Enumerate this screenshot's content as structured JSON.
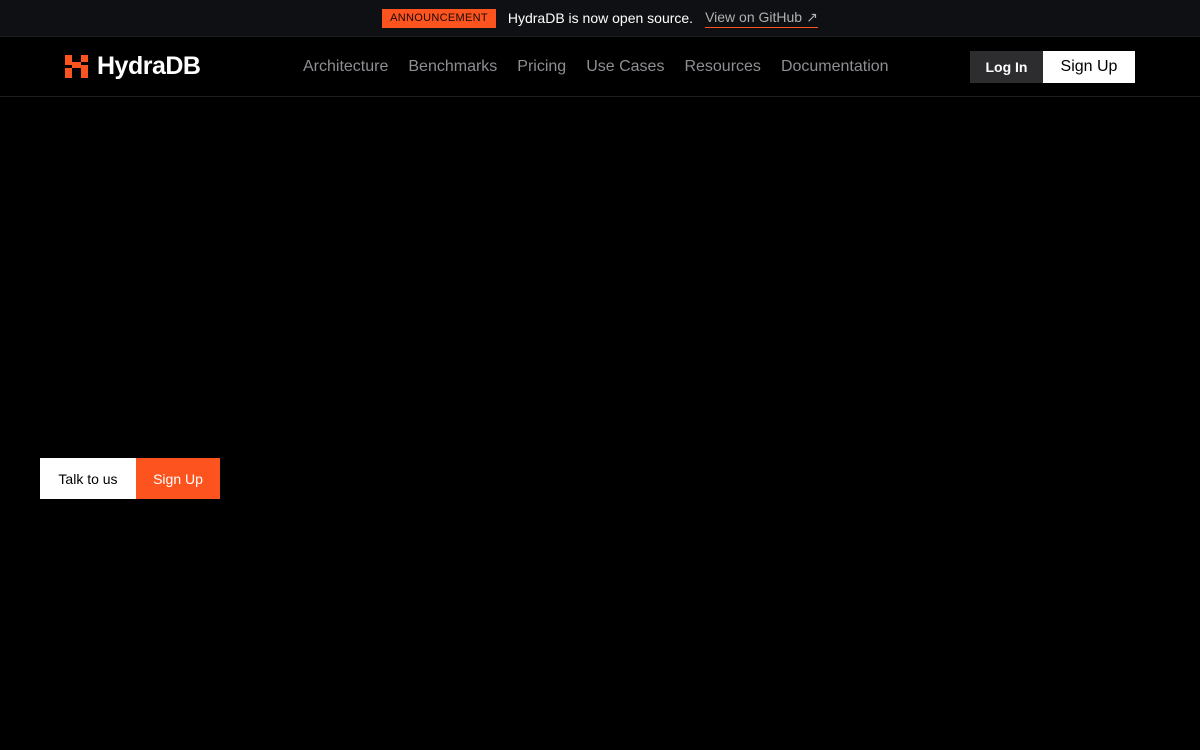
{
  "announcement": {
    "badge": "ANNOUNCEMENT",
    "text": "HydraDB is now open source.",
    "link_label": "View on GitHub",
    "link_arrow": "↗"
  },
  "brand": {
    "name": "HydraDB",
    "logo_icon": "hydradb-logo-icon",
    "accent_color": "#fc531f"
  },
  "nav": {
    "links": [
      {
        "label": "Architecture"
      },
      {
        "label": "Benchmarks"
      },
      {
        "label": "Pricing"
      },
      {
        "label": "Use Cases"
      },
      {
        "label": "Resources"
      },
      {
        "label": "Documentation"
      }
    ],
    "login_label": "Log In",
    "signup_label": "Sign Up"
  },
  "hero": {
    "talk_label": "Talk to us",
    "signup_label": "Sign Up"
  }
}
